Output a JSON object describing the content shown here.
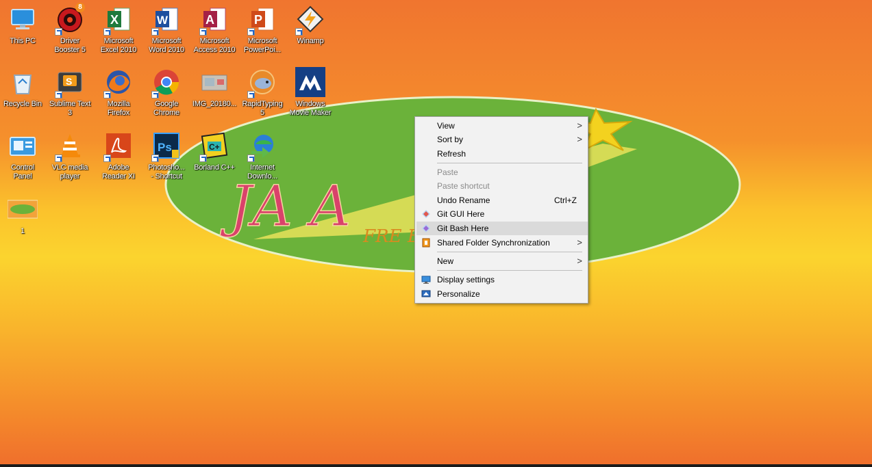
{
  "desktop": {
    "icons": [
      {
        "label": "This PC"
      },
      {
        "label": "Driver\nBooster 5",
        "badge": "8"
      },
      {
        "label": "Microsoft\nExcel 2010"
      },
      {
        "label": "Microsoft\nWord 2010"
      },
      {
        "label": "Microsoft\nAccess 2010"
      },
      {
        "label": "Microsoft\nPowerPoi..."
      },
      {
        "label": "Winamp"
      },
      {
        "label": "Recycle Bin"
      },
      {
        "label": "Sublime Text\n3"
      },
      {
        "label": "Mozilla\nFirefox"
      },
      {
        "label": "Google\nChrome"
      },
      {
        "label": "IMG_20180..."
      },
      {
        "label": "RapidTyping\n5"
      },
      {
        "label": "Windows\nMovie Maker"
      },
      {
        "label": "Control\nPanel"
      },
      {
        "label": "VLC media\nplayer"
      },
      {
        "label": "Adobe\nReader XI"
      },
      {
        "label": "Photosho...\n- Shortcut"
      },
      {
        "label": "Borland C++"
      },
      {
        "label": "Internet\nDownlo..."
      },
      {
        "label": "1"
      }
    ]
  },
  "wallpaper": {
    "logo_text": "JA      A",
    "tagline": "FRE                  E YOU",
    "colors": {
      "ellipse": "#6bb23a",
      "text": "#d9426b",
      "star": "#f3d21f"
    }
  },
  "context_menu": {
    "items": {
      "view": {
        "label": "View"
      },
      "sort_by": {
        "label": "Sort by"
      },
      "refresh": {
        "label": "Refresh"
      },
      "paste": {
        "label": "Paste"
      },
      "paste_shortcut": {
        "label": "Paste shortcut"
      },
      "undo_rename": {
        "label": "Undo Rename",
        "shortcut": "Ctrl+Z"
      },
      "git_gui": {
        "label": "Git GUI Here"
      },
      "git_bash": {
        "label": "Git Bash Here"
      },
      "shared_folder": {
        "label": "Shared Folder Synchronization"
      },
      "new": {
        "label": "New"
      },
      "display_settings": {
        "label": "Display settings"
      },
      "personalize": {
        "label": "Personalize"
      }
    },
    "submenu_glyph": ">"
  }
}
